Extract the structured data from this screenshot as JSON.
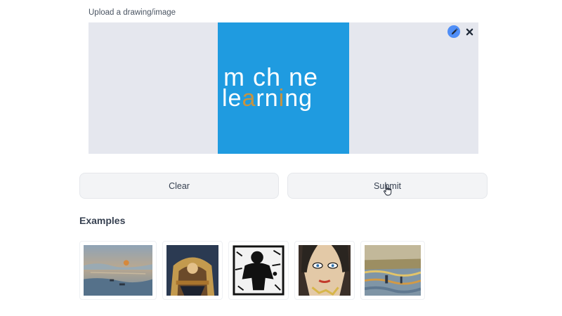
{
  "upload": {
    "label": "Upload a drawing/image",
    "preview_words": {
      "line1": "m  ch  ne",
      "line2": "learning",
      "line2_parts": [
        "le",
        "a",
        "rn",
        "i",
        "ng"
      ],
      "accent_color": "#c8933f",
      "background_color": "#1f9be0"
    },
    "edit_icon": "pencil-icon",
    "close_icon": "close-icon"
  },
  "actions": {
    "clear_label": "Clear",
    "submit_label": "Submit"
  },
  "examples": {
    "title": "Examples",
    "items": [
      {
        "name": "impressionist-harbor"
      },
      {
        "name": "ornate-figure"
      },
      {
        "name": "black-white-figure"
      },
      {
        "name": "pop-art-woman"
      },
      {
        "name": "impressionist-water"
      }
    ]
  },
  "colors": {
    "panel": "#e5e7ee",
    "button_bg": "#f3f4f6",
    "edit_button": "#4f8ef7"
  }
}
